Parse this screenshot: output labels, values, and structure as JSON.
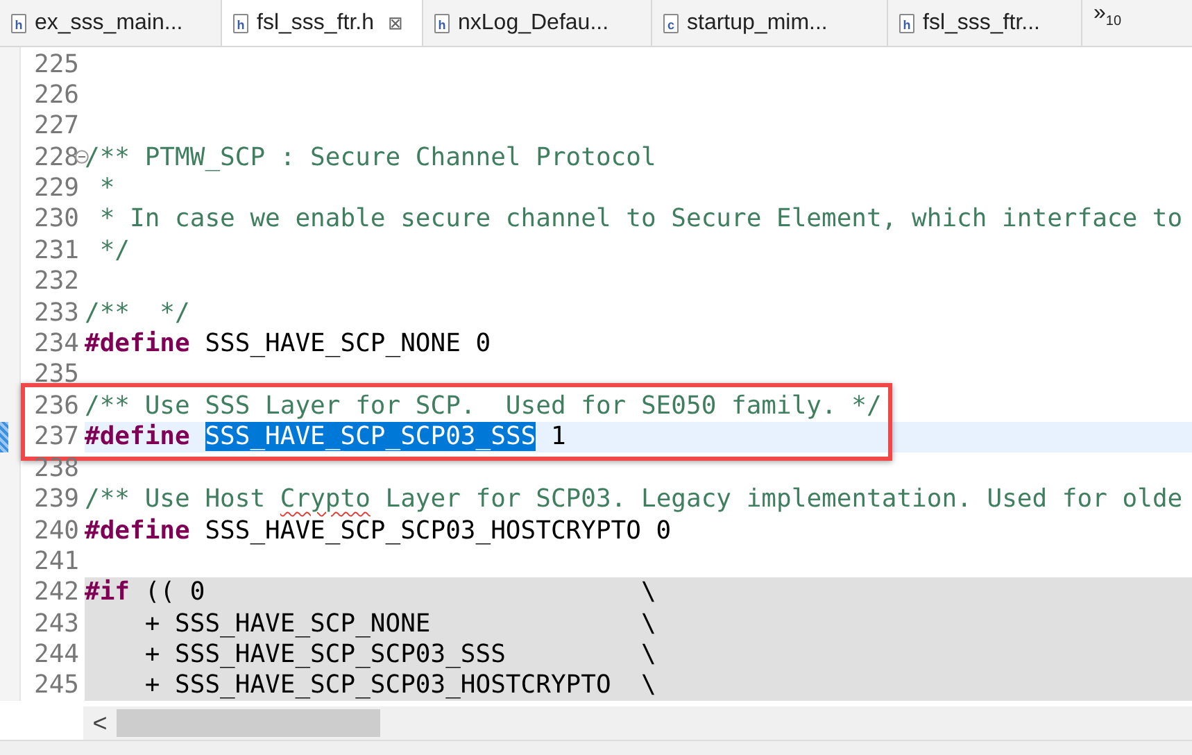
{
  "tabs": [
    {
      "label": "ex_sss_main...",
      "file_type": "h",
      "selected": false
    },
    {
      "label": "fsl_sss_ftr.h",
      "file_type": "h",
      "selected": true,
      "close": "⊠"
    },
    {
      "label": "nxLog_Defau...",
      "file_type": "h",
      "selected": false
    },
    {
      "label": "startup_mim...",
      "file_type": "c",
      "selected": false
    },
    {
      "label": "fsl_sss_ftr...",
      "file_type": "h",
      "selected": false
    }
  ],
  "overflow": {
    "symbol": "»",
    "count": "10"
  },
  "editor": {
    "lines": [
      {
        "number": "225",
        "current": false,
        "inactive": false
      },
      {
        "number": "226",
        "current": false,
        "inactive": false
      },
      {
        "number": "227",
        "current": false,
        "inactive": false
      },
      {
        "number": "228",
        "current": false,
        "inactive": false,
        "folded": false,
        "tokens": [
          {
            "kind": "comment",
            "text": "/** PTMW_SCP : Secure Channel Protocol"
          }
        ]
      },
      {
        "number": "229",
        "current": false,
        "inactive": false,
        "tokens": [
          {
            "kind": "comment",
            "text": " *"
          }
        ]
      },
      {
        "number": "230",
        "current": false,
        "inactive": false,
        "tokens": [
          {
            "kind": "comment",
            "text": " * In case we enable secure channel to Secure Element, which interface to"
          }
        ]
      },
      {
        "number": "231",
        "current": false,
        "inactive": false,
        "tokens": [
          {
            "kind": "comment",
            "text": " */"
          }
        ]
      },
      {
        "number": "232",
        "current": false,
        "inactive": false
      },
      {
        "number": "233",
        "current": false,
        "inactive": false,
        "tokens": [
          {
            "kind": "comment",
            "text": "/**  */"
          }
        ]
      },
      {
        "number": "234",
        "current": false,
        "inactive": false,
        "tokens": [
          {
            "kind": "keyword",
            "text": "#define"
          },
          {
            "kind": "plain",
            "text": " SSS_HAVE_SCP_NONE 0"
          }
        ]
      },
      {
        "number": "235",
        "current": false,
        "inactive": false
      },
      {
        "number": "236",
        "current": false,
        "inactive": false,
        "annotated": true,
        "tokens": [
          {
            "kind": "comment",
            "text": "/** Use SSS Layer for SCP.  Used for SE050 family. */"
          }
        ]
      },
      {
        "number": "237",
        "current": true,
        "inactive": false,
        "annotated": true,
        "tokens": [
          {
            "kind": "keyword",
            "text": "#define "
          },
          {
            "kind": "selected",
            "text": "SSS_HAVE_SCP_SCP03_SSS"
          },
          {
            "kind": "plain",
            "text": " 1"
          }
        ]
      },
      {
        "number": "238",
        "current": false,
        "inactive": false
      },
      {
        "number": "239",
        "current": false,
        "inactive": false,
        "tokens": [
          {
            "kind": "comment",
            "text": "/** Use Host "
          },
          {
            "kind": "comment",
            "text": "Crypto",
            "misspelled": true
          },
          {
            "kind": "comment",
            "text": " Layer for SCP03. Legacy implementation. Used for olde"
          }
        ]
      },
      {
        "number": "240",
        "current": false,
        "inactive": false,
        "tokens": [
          {
            "kind": "keyword",
            "text": "#define"
          },
          {
            "kind": "plain",
            "text": " SSS_HAVE_SCP_SCP03_HOSTCRYPTO 0"
          }
        ]
      },
      {
        "number": "241",
        "current": false,
        "inactive": false
      },
      {
        "number": "242",
        "current": false,
        "inactive": true,
        "tokens": [
          {
            "kind": "keyword",
            "text": "#if"
          },
          {
            "kind": "plain",
            "text": " (( 0                             \\"
          }
        ]
      },
      {
        "number": "243",
        "current": false,
        "inactive": true,
        "tokens": [
          {
            "kind": "plain",
            "text": "    + SSS_HAVE_SCP_NONE              \\"
          }
        ]
      },
      {
        "number": "244",
        "current": false,
        "inactive": true,
        "tokens": [
          {
            "kind": "plain",
            "text": "    + SSS_HAVE_SCP_SCP03_SSS         \\"
          }
        ]
      },
      {
        "number": "245",
        "current": false,
        "inactive": true,
        "tokens": [
          {
            "kind": "plain",
            "text": "    + SSS_HAVE_SCP_SCP03_HOSTCRYPTO  \\"
          }
        ]
      }
    ]
  },
  "scrollbar": {
    "arrow": "<"
  }
}
